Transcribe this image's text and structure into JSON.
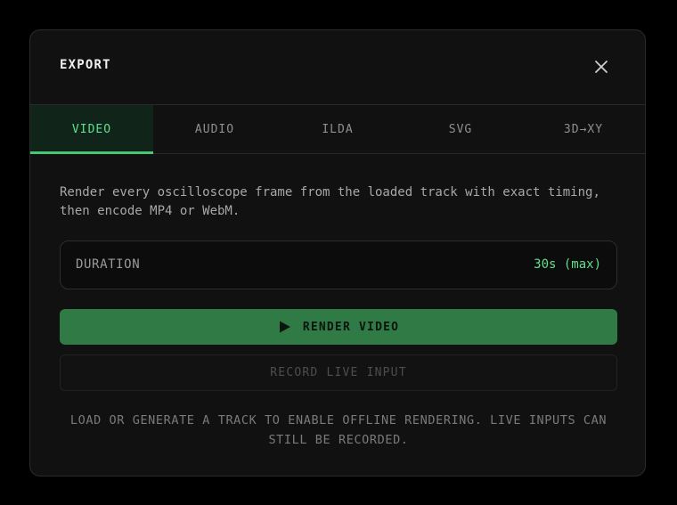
{
  "dialog": {
    "title": "EXPORT",
    "close_icon": "close-icon"
  },
  "tabs": [
    {
      "label": "VIDEO",
      "active": true
    },
    {
      "label": "AUDIO",
      "active": false
    },
    {
      "label": "ILDA",
      "active": false
    },
    {
      "label": "SVG",
      "active": false
    },
    {
      "label": "3D→XY",
      "active": false
    }
  ],
  "description": "Render every oscilloscope frame from the loaded track with exact timing, then encode MP4 or WebM.",
  "duration": {
    "label": "DURATION",
    "value": "30s (max)"
  },
  "actions": {
    "render_label": "RENDER VIDEO",
    "render_icon": "play-icon",
    "record_label": "RECORD LIVE INPUT"
  },
  "footnote": "LOAD OR GENERATE A TRACK TO ENABLE OFFLINE RENDERING. LIVE INPUTS CAN STILL BE RECORDED.",
  "colors": {
    "accent": "#5ee08c",
    "accent_button": "#2f7a45",
    "background": "#111111"
  }
}
